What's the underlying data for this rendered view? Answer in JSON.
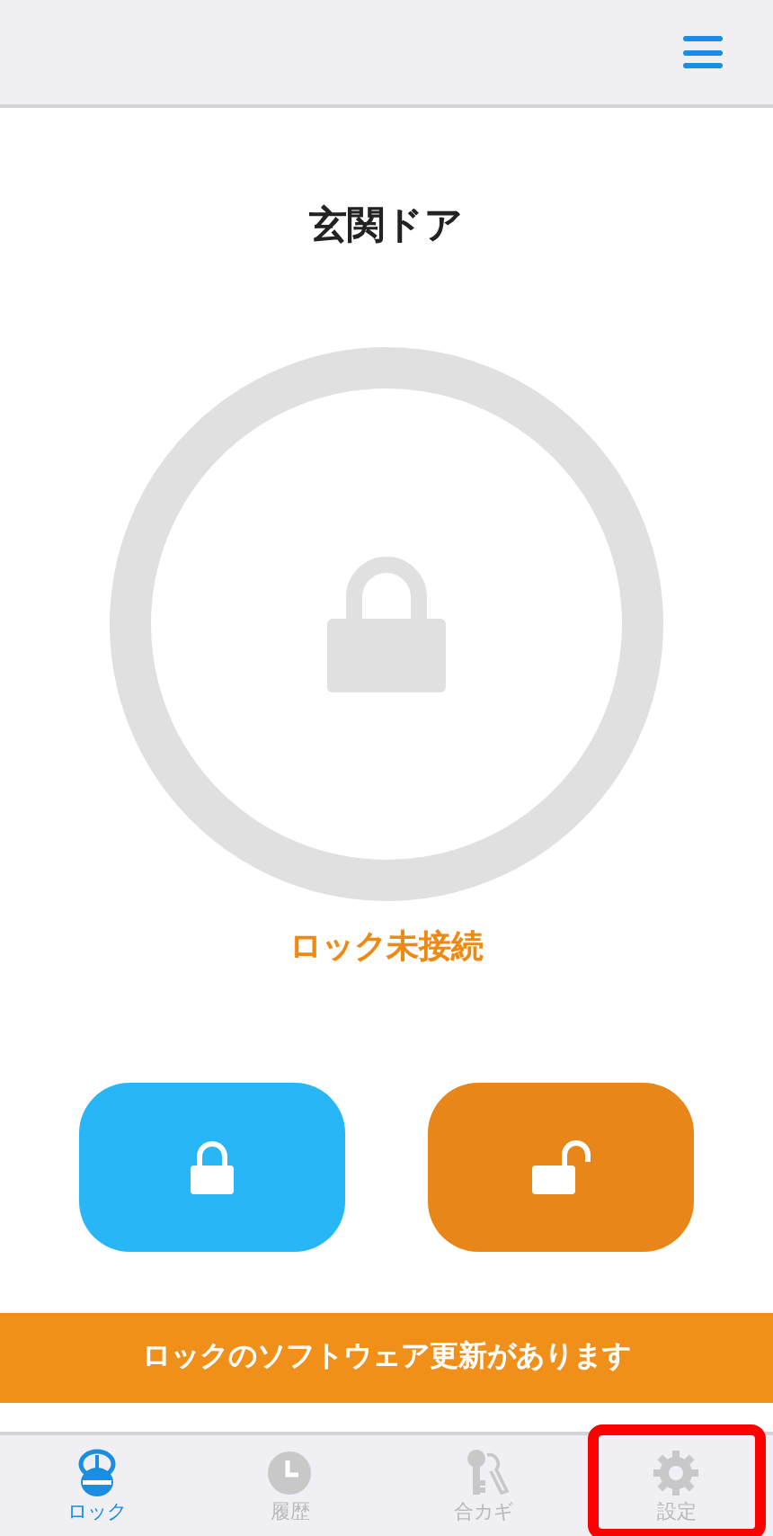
{
  "lock": {
    "name": "玄関ドア",
    "status": "ロック未接続",
    "connected": false
  },
  "actions": [
    {
      "kind": "lock"
    },
    {
      "kind": "unlock"
    }
  ],
  "banner": {
    "text": "ロックのソフトウェア更新があります"
  },
  "tabs": [
    {
      "kind": "lock",
      "label": "ロック",
      "selected": true,
      "highlighted": false
    },
    {
      "kind": "history",
      "label": "履歴",
      "selected": false,
      "highlighted": false
    },
    {
      "kind": "keys",
      "label": "合カギ",
      "selected": false,
      "highlighted": false
    },
    {
      "kind": "settings",
      "label": "設定",
      "selected": false,
      "highlighted": true
    }
  ]
}
